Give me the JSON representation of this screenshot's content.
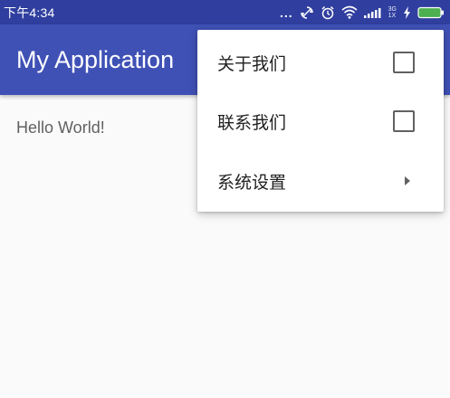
{
  "status_bar": {
    "time": "下午4:34",
    "more_indicator": "...",
    "network_label_top": "3G",
    "network_label_bottom": "1X",
    "icons": [
      "sync-icon",
      "alarm-icon",
      "wifi-icon",
      "signal-icon",
      "charging-icon",
      "battery-icon"
    ]
  },
  "app_bar": {
    "title": "My Application"
  },
  "content": {
    "text": "Hello World!"
  },
  "menu": {
    "items": [
      {
        "label": "关于我们",
        "type": "checkbox",
        "checked": false
      },
      {
        "label": "联系我们",
        "type": "checkbox",
        "checked": false
      },
      {
        "label": "系统设置",
        "type": "submenu"
      }
    ]
  },
  "colors": {
    "status_bar": "#303f9f",
    "app_bar": "#3f51b5",
    "battery": "#4caf50"
  }
}
